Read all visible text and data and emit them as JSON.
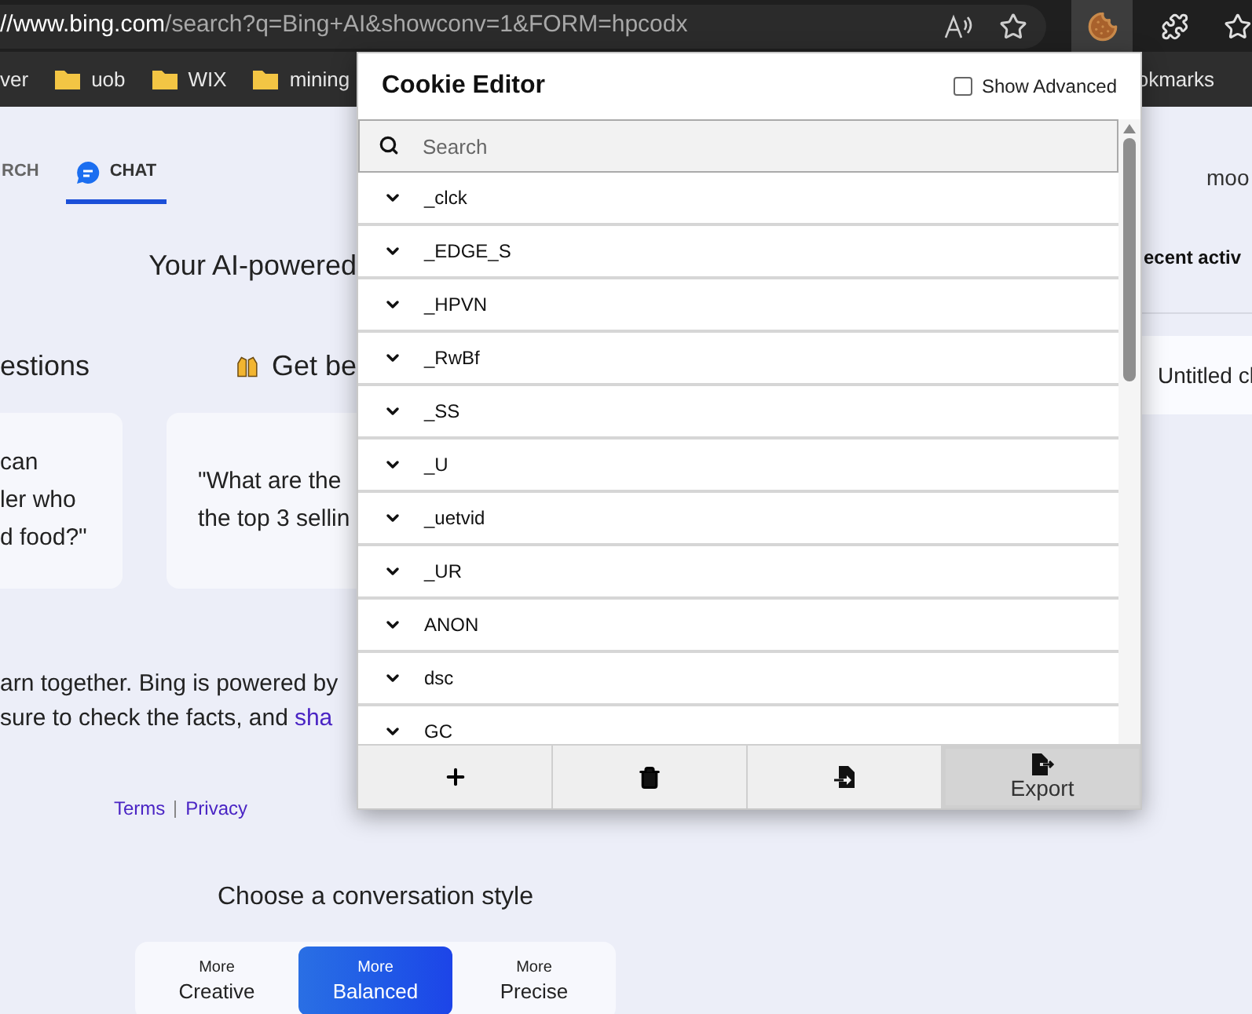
{
  "browser": {
    "address": {
      "host": "//www.bing.com",
      "path": "/search?q=Bing+AI&showconv=1&FORM=hpcodx"
    },
    "extension_button": {
      "active": true
    }
  },
  "bookmarks": [
    {
      "label": "ver",
      "kind": "text"
    },
    {
      "label": "uob",
      "kind": "folder"
    },
    {
      "label": "WIX",
      "kind": "folder"
    },
    {
      "label": "mining",
      "kind": "folder"
    }
  ],
  "bookmarks_right": "okmarks",
  "page": {
    "tabs": [
      {
        "label": "RCH",
        "selected": false
      },
      {
        "label": "CHAT",
        "selected": true
      }
    ],
    "user": "moo",
    "tagline": "Your AI-powered",
    "sections": [
      "estions",
      "Get be"
    ],
    "cards": [
      {
        "lines": [
          "can",
          "ler who",
          "d food?\""
        ]
      },
      {
        "lines": [
          "\"What are the",
          "the top 3 sellin"
        ]
      }
    ],
    "footer": {
      "line1": "arn together. Bing is powered by",
      "line2": "sure to check the facts, and",
      "link": "sha"
    },
    "links": [
      "Terms",
      "Privacy"
    ],
    "style_title": "Choose a conversation style",
    "styles": [
      {
        "top": "More",
        "label": "Creative",
        "selected": false
      },
      {
        "top": "More",
        "label": "Balanced",
        "selected": true
      },
      {
        "top": "More",
        "label": "Precise",
        "selected": false
      }
    ]
  },
  "sidebar": {
    "title": "ecent activ",
    "items": [
      "Untitled cl"
    ]
  },
  "cookie_editor": {
    "title": "Cookie Editor",
    "show_advanced": {
      "label": "Show Advanced",
      "checked": false
    },
    "search": {
      "placeholder": "Search"
    },
    "cookies": [
      {
        "name": "_clck"
      },
      {
        "name": "_EDGE_S"
      },
      {
        "name": "_HPVN"
      },
      {
        "name": "_RwBf"
      },
      {
        "name": "_SS"
      },
      {
        "name": "_U"
      },
      {
        "name": "_uetvid"
      },
      {
        "name": "_UR"
      },
      {
        "name": "ANON"
      },
      {
        "name": "dsc"
      },
      {
        "name": "GC"
      }
    ],
    "actions": [
      {
        "kind": "add",
        "selected": false
      },
      {
        "kind": "delete",
        "selected": false
      },
      {
        "kind": "import",
        "selected": false
      },
      {
        "kind": "export",
        "label": "Export",
        "selected": true
      }
    ]
  }
}
